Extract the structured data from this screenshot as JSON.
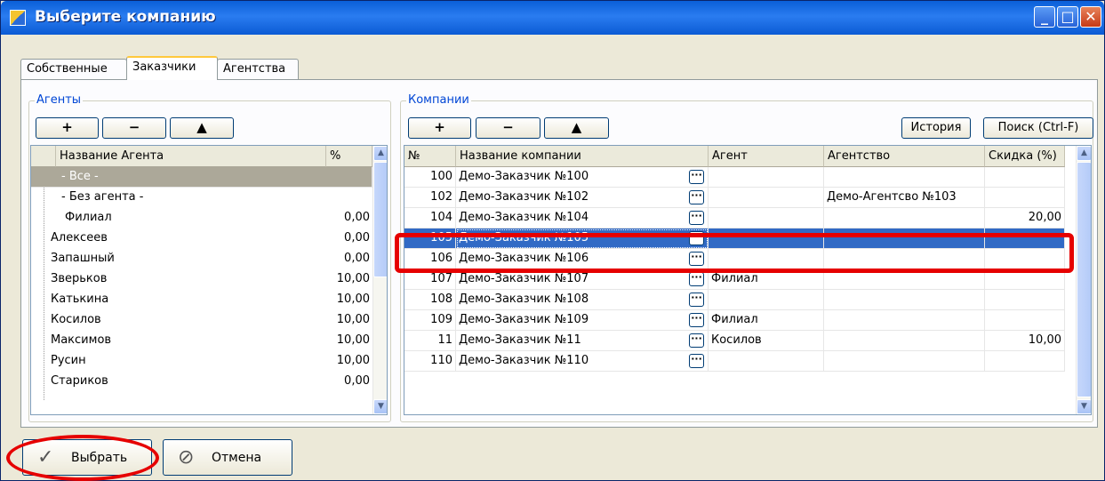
{
  "window": {
    "title": "Выберите компанию"
  },
  "tabs": [
    "Собственные",
    "Заказчики",
    "Агентства"
  ],
  "agents": {
    "group_title": "Агенты",
    "toolbar": [
      "+",
      "−",
      "▲"
    ],
    "columns": [
      "Название Агента",
      "%"
    ],
    "rows": [
      {
        "name": "- Все -",
        "pct": ""
      },
      {
        "name": "- Без агента -",
        "pct": ""
      },
      {
        "name": "Филиал",
        "pct": "0,00"
      },
      {
        "name": "Алексеев",
        "pct": "0,00"
      },
      {
        "name": "Запашный",
        "pct": "0,00"
      },
      {
        "name": "Зверьков",
        "pct": "10,00"
      },
      {
        "name": "Катькина",
        "pct": "10,00"
      },
      {
        "name": "Косилов",
        "pct": "10,00"
      },
      {
        "name": "Максимов",
        "pct": "10,00"
      },
      {
        "name": "Русин",
        "pct": "10,00"
      },
      {
        "name": "Стариков",
        "pct": "0,00"
      }
    ]
  },
  "companies": {
    "group_title": "Компании",
    "toolbar": [
      "+",
      "−",
      "▲"
    ],
    "history_label": "История",
    "search_label": "Поиск (Ctrl-F)",
    "columns": [
      "№",
      "Название компании",
      "Агент",
      "Агентство",
      "Скидка (%)"
    ],
    "rows": [
      {
        "no": "100",
        "name": "Демо-Заказчик №100",
        "agent": "",
        "agency": "",
        "discount": ""
      },
      {
        "no": "102",
        "name": "Демо-Заказчик №102",
        "agent": "",
        "agency": "Демо-Агентсво №103",
        "discount": ""
      },
      {
        "no": "104",
        "name": "Демо-Заказчик №104",
        "agent": "",
        "agency": "",
        "discount": "20,00"
      },
      {
        "no": "105",
        "name": "Демо-Заказчик №105",
        "agent": "",
        "agency": "",
        "discount": ""
      },
      {
        "no": "106",
        "name": "Демо-Заказчик №106",
        "agent": "",
        "agency": "",
        "discount": ""
      },
      {
        "no": "107",
        "name": "Демо-Заказчик №107",
        "agent": "Филиал",
        "agency": "",
        "discount": ""
      },
      {
        "no": "108",
        "name": "Демо-Заказчик №108",
        "agent": "",
        "agency": "",
        "discount": ""
      },
      {
        "no": "109",
        "name": "Демо-Заказчик №109",
        "agent": "Филиал",
        "agency": "",
        "discount": ""
      },
      {
        "no": "11",
        "name": "Демо-Заказчик №11",
        "agent": "Косилов",
        "agency": "",
        "discount": "10,00"
      },
      {
        "no": "110",
        "name": "Демо-Заказчик №110",
        "agent": "",
        "agency": "",
        "discount": ""
      }
    ]
  },
  "buttons": {
    "select": "Выбрать",
    "cancel": "Отмена"
  }
}
